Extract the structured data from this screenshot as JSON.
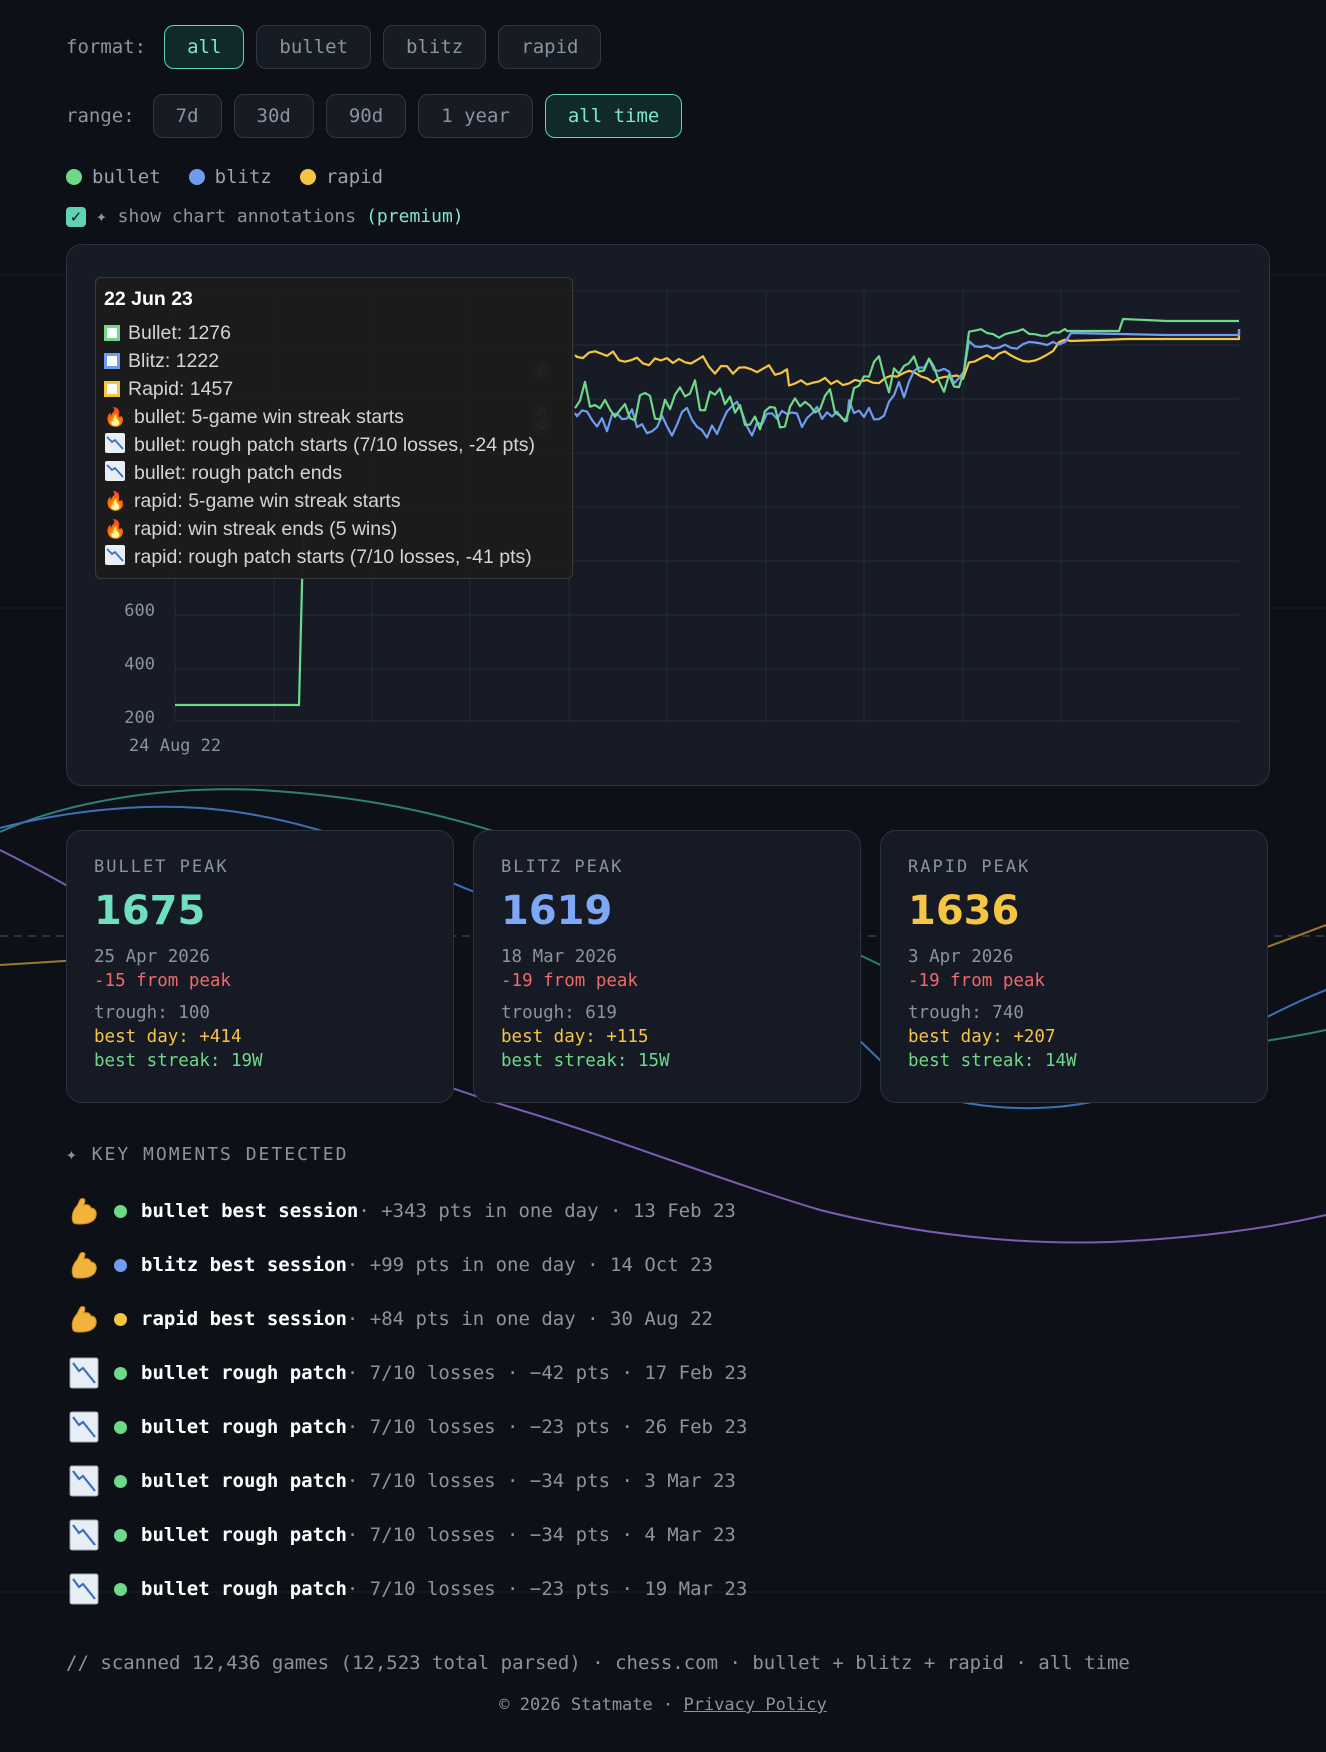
{
  "filters": {
    "format_label": "format:",
    "format": [
      "all",
      "bullet",
      "blitz",
      "rapid"
    ],
    "format_active": 0,
    "range_label": "range:",
    "range": [
      "7d",
      "30d",
      "90d",
      "1 year",
      "all time"
    ],
    "range_active": 4
  },
  "legend": [
    {
      "name": "bullet",
      "color": "#6fd98a"
    },
    {
      "name": "blitz",
      "color": "#6f9cf0"
    },
    {
      "name": "rapid",
      "color": "#f6c544"
    }
  ],
  "annotations": {
    "label": "✦ show chart annotations",
    "premium": "(premium)",
    "checked": true
  },
  "chart_data": {
    "type": "line",
    "y_ticks": [
      200,
      400,
      600
    ],
    "x_start_label": "24 Aug 22",
    "series": [
      {
        "name": "bullet",
        "color": "#6fd98a"
      },
      {
        "name": "blitz",
        "color": "#6f9cf0"
      },
      {
        "name": "rapid",
        "color": "#f6c544"
      }
    ]
  },
  "tooltip": {
    "date": "22 Jun 23",
    "values": [
      {
        "text": "Bullet: 1276",
        "color": "#6fd98a"
      },
      {
        "text": "Blitz: 1222",
        "color": "#6f9cf0"
      },
      {
        "text": "Rapid: 1457",
        "color": "#f6c544"
      }
    ],
    "events": [
      {
        "icon": "fire",
        "text": "bullet: 5-game win streak starts"
      },
      {
        "icon": "chart-down",
        "text": "bullet: rough patch starts (7/10 losses, -24 pts)"
      },
      {
        "icon": "chart-down",
        "text": "bullet: rough patch ends"
      },
      {
        "icon": "fire",
        "text": "rapid: 5-game win streak starts"
      },
      {
        "icon": "fire",
        "text": "rapid: win streak ends (5 wins)"
      },
      {
        "icon": "chart-down",
        "text": "rapid: rough patch starts (7/10 losses, -41 pts)"
      }
    ]
  },
  "peaks": [
    {
      "label": "BULLET PEAK",
      "value": "1675",
      "color": "#6ee0c0",
      "date": "25 Apr 2026",
      "from": "-15 from peak",
      "trough": "trough: 100",
      "best_day": "best day: +414",
      "best_streak": "best streak: 19W"
    },
    {
      "label": "BLITZ PEAK",
      "value": "1619",
      "color": "#7ea8f5",
      "date": "18 Mar 2026",
      "from": "-19 from peak",
      "trough": "trough: 619",
      "best_day": "best day: +115",
      "best_streak": "best streak: 15W"
    },
    {
      "label": "RAPID PEAK",
      "value": "1636",
      "color": "#f6c544",
      "date": "3 Apr 2026",
      "from": "-19 from peak",
      "trough": "trough: 740",
      "best_day": "best day: +207",
      "best_streak": "best streak: 14W"
    }
  ],
  "key_moments": {
    "heading": "✦ KEY MOMENTS DETECTED",
    "items": [
      {
        "icon": "muscle",
        "color": "#6fd98a",
        "title": "bullet best session",
        "rest": " · +343 pts in one day · 13 Feb 23"
      },
      {
        "icon": "muscle",
        "color": "#6f9cf0",
        "title": "blitz best session",
        "rest": " · +99 pts in one day · 14 Oct 23"
      },
      {
        "icon": "muscle",
        "color": "#f6c544",
        "title": "rapid best session",
        "rest": " · +84 pts in one day · 30 Aug 22"
      },
      {
        "icon": "chart-down",
        "color": "#6fd98a",
        "title": "bullet rough patch",
        "rest": " · 7/10 losses · −42 pts · 17 Feb 23"
      },
      {
        "icon": "chart-down",
        "color": "#6fd98a",
        "title": "bullet rough patch",
        "rest": " · 7/10 losses · −23 pts · 26 Feb 23"
      },
      {
        "icon": "chart-down",
        "color": "#6fd98a",
        "title": "bullet rough patch",
        "rest": " · 7/10 losses · −34 pts · 3 Mar 23"
      },
      {
        "icon": "chart-down",
        "color": "#6fd98a",
        "title": "bullet rough patch",
        "rest": " · 7/10 losses · −34 pts · 4 Mar 23"
      },
      {
        "icon": "chart-down",
        "color": "#6fd98a",
        "title": "bullet rough patch",
        "rest": " · 7/10 losses · −23 pts · 19 Mar 23"
      }
    ]
  },
  "footer": {
    "scan": "// scanned 12,436 games (12,523 total parsed) · chess.com · bullet + blitz + rapid · all time",
    "copyright": "© 2026 Statmate  ·  ",
    "privacy": "Privacy Policy"
  }
}
